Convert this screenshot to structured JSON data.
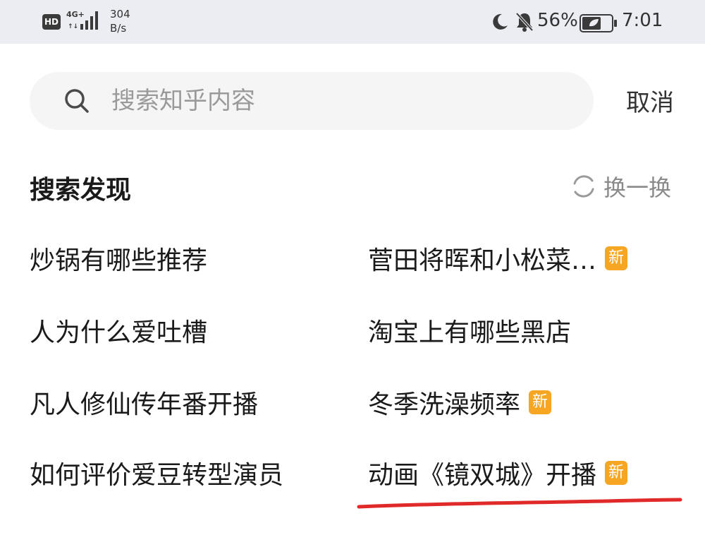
{
  "status_bar": {
    "hd": "HD",
    "network": "4G+",
    "speed_value": "304",
    "speed_unit": "B/s",
    "battery_percent": "56%",
    "time": "7:01",
    "icons": [
      "moon-icon",
      "bell-off-icon",
      "battery-icon"
    ]
  },
  "search": {
    "placeholder": "搜索知乎内容",
    "value": "",
    "cancel_label": "取消"
  },
  "discover": {
    "title": "搜索发现",
    "refresh_label": "换一换",
    "new_badge": "新",
    "items": [
      {
        "text": "炒锅有哪些推荐",
        "is_new": false
      },
      {
        "text": "菅田将晖和小松菜…",
        "is_new": true
      },
      {
        "text": "人为什么爱吐槽",
        "is_new": false
      },
      {
        "text": "淘宝上有哪些黑店",
        "is_new": false
      },
      {
        "text": "凡人修仙传年番开播",
        "is_new": false
      },
      {
        "text": "冬季洗澡频率",
        "is_new": true
      },
      {
        "text": "如何评价爱豆转型演员",
        "is_new": false
      },
      {
        "text": "动画《镜双城》开播",
        "is_new": true
      }
    ]
  },
  "colors": {
    "status_bg": "#ecedf2",
    "search_bg": "#f5f5f6",
    "badge": "#f6a623",
    "annotation": "#e02a2a"
  }
}
